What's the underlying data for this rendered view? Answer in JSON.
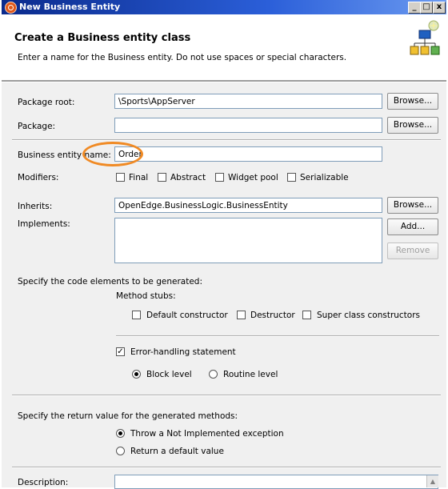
{
  "window": {
    "title": "New Business Entity",
    "controls": [
      "_",
      "□",
      "x"
    ]
  },
  "header": {
    "title": "Create a Business entity class",
    "description": "Enter a name for the Business entity. Do not use spaces or special characters.",
    "icon": "class-diagram-wizard-icon"
  },
  "form": {
    "package_root": {
      "label": "Package root:",
      "value": "\\Sports\\AppServer",
      "button": "Browse..."
    },
    "package": {
      "label": "Package:",
      "value": "",
      "button": "Browse..."
    },
    "entity_name": {
      "label": "Business entity name:",
      "value": "Order"
    },
    "modifiers": {
      "label": "Modifiers:",
      "options": [
        {
          "label": "Final",
          "checked": false
        },
        {
          "label": "Abstract",
          "checked": false
        },
        {
          "label": "Widget pool",
          "checked": false
        },
        {
          "label": "Serializable",
          "checked": false
        }
      ]
    },
    "inherits": {
      "label": "Inherits:",
      "value": "OpenEdge.BusinessLogic.BusinessEntity",
      "button": "Browse..."
    },
    "implements": {
      "label": "Implements:",
      "add_button": "Add...",
      "remove_button": "Remove"
    },
    "code_elements": {
      "label": "Specify the code elements to be generated:",
      "method_stubs_label": "Method stubs:",
      "stubs": [
        {
          "label": "Default constructor",
          "checked": false
        },
        {
          "label": "Destructor",
          "checked": false
        },
        {
          "label": "Super class constructors",
          "checked": false
        }
      ],
      "error_handling": {
        "label": "Error-handling statement",
        "checked": true
      },
      "levels": [
        {
          "label": "Block level",
          "selected": true
        },
        {
          "label": "Routine level",
          "selected": false
        }
      ]
    },
    "return_value": {
      "label": "Specify the return value for the generated methods:",
      "options": [
        {
          "label": "Throw a Not Implemented exception",
          "selected": true
        },
        {
          "label": "Return a default value",
          "selected": false
        }
      ]
    },
    "description": {
      "label": "Description:",
      "value": ""
    }
  },
  "colors": {
    "titlebar": "#0a2a8c",
    "highlight": "#f08a24",
    "field_border": "#7f9db9"
  }
}
